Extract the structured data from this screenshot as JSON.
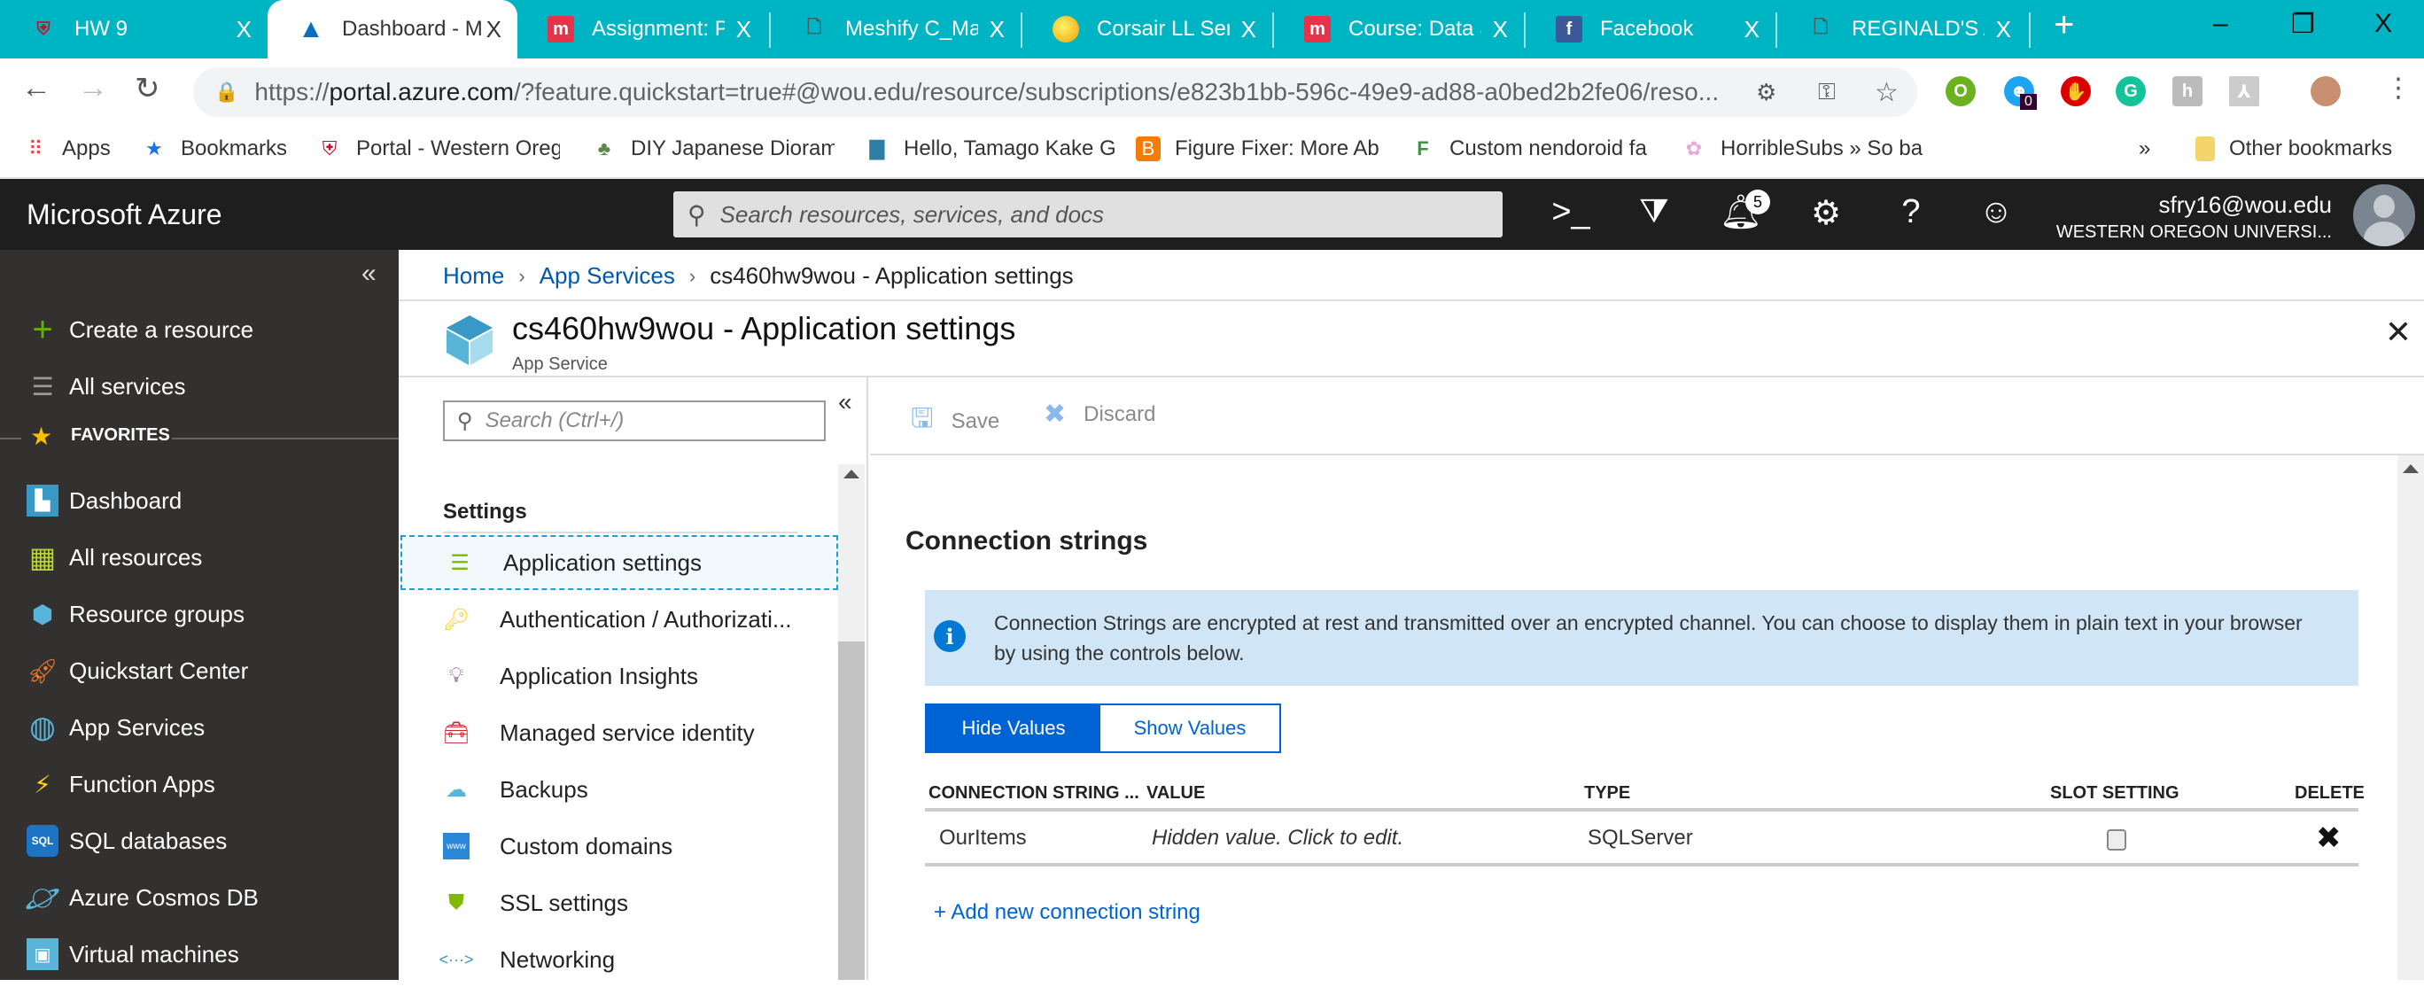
{
  "browser": {
    "tabs": [
      {
        "label": "HW 9",
        "icon": "wou-crest-icon",
        "active": false
      },
      {
        "label": "Dashboard - Microsoft Azure",
        "icon": "azure-logo-icon",
        "active": true
      },
      {
        "label": "Assignment: Po",
        "icon": "moodle-icon",
        "active": false
      },
      {
        "label": "Meshify C_Man",
        "icon": "document-icon",
        "active": false
      },
      {
        "label": "Corsair LL Series",
        "icon": "egg-icon",
        "active": false
      },
      {
        "label": "Course: Data S",
        "icon": "moodle-icon",
        "active": false
      },
      {
        "label": "Facebook",
        "icon": "facebook-icon",
        "active": false
      },
      {
        "label": "REGINALD'S AI",
        "icon": "document-icon",
        "active": false
      }
    ],
    "new_tab": "+",
    "tab_close": "X",
    "window_controls": {
      "minimize": "–",
      "restore": "❐",
      "close": "X"
    },
    "url_prefix": "https://",
    "url_host": "portal.azure.com",
    "url_rest": "/?feature.quickstart=true#@wou.edu/resource/subscriptions/e823b1bb-596c-49e9-ad88-a0bed2b2fe06/reso...",
    "extension_badge": "0",
    "bookmarks": [
      {
        "label": "Apps",
        "icon": "apps-grid-icon"
      },
      {
        "label": "Bookmarks",
        "icon": "star-icon"
      },
      {
        "label": "Portal - Western Oreg",
        "icon": "wou-crest-icon"
      },
      {
        "label": "DIY Japanese Dioram",
        "icon": "plant-icon"
      },
      {
        "label": "Hello, Tamago Kake G",
        "icon": "bin-icon"
      },
      {
        "label": "Figure Fixer: More Ab",
        "icon": "blogger-icon"
      },
      {
        "label": "Custom nendoroid fa",
        "icon": "fp-icon"
      },
      {
        "label": "HorribleSubs » So ba",
        "icon": "flower-icon"
      }
    ],
    "bookmarks_overflow": "»",
    "other_bookmarks": "Other bookmarks"
  },
  "azure": {
    "brand": "Microsoft Azure",
    "search_placeholder": "Search resources, services, and docs",
    "notifications_count": "5",
    "account_email": "sfry16@wou.edu",
    "account_org": "WESTERN OREGON UNIVERSI..."
  },
  "sidebar": {
    "top_items": [
      {
        "label": "Create a resource",
        "icon": "plus-icon"
      },
      {
        "label": "All services",
        "icon": "list-icon"
      }
    ],
    "favorites_label": "FAVORITES",
    "favorites": [
      {
        "label": "Dashboard",
        "icon": "dashboard-icon"
      },
      {
        "label": "All resources",
        "icon": "grid-icon"
      },
      {
        "label": "Resource groups",
        "icon": "resource-group-icon"
      },
      {
        "label": "Quickstart Center",
        "icon": "rocket-icon"
      },
      {
        "label": "App Services",
        "icon": "app-services-icon"
      },
      {
        "label": "Function Apps",
        "icon": "function-apps-icon"
      },
      {
        "label": "SQL databases",
        "icon": "sql-icon"
      },
      {
        "label": "Azure Cosmos DB",
        "icon": "cosmos-icon"
      },
      {
        "label": "Virtual machines",
        "icon": "vm-icon"
      }
    ]
  },
  "breadcrumb": [
    {
      "label": "Home",
      "link": true
    },
    {
      "label": "App Services",
      "link": true
    },
    {
      "label": "cs460hw9wou - Application settings",
      "link": false
    }
  ],
  "blade": {
    "title": "cs460hw9wou - Application settings",
    "subtitle": "App Service"
  },
  "resource_menu": {
    "search_placeholder": "Search (Ctrl+/)",
    "section": "Settings",
    "items": [
      {
        "label": "Application settings",
        "icon": "app-settings-icon",
        "selected": true
      },
      {
        "label": "Authentication / Authorizati...",
        "icon": "key-icon",
        "selected": false
      },
      {
        "label": "Application Insights",
        "icon": "lightbulb-icon",
        "selected": false
      },
      {
        "label": "Managed service identity",
        "icon": "toolbox-icon",
        "selected": false
      },
      {
        "label": "Backups",
        "icon": "cloud-icon",
        "selected": false
      },
      {
        "label": "Custom domains",
        "icon": "www-icon",
        "selected": false
      },
      {
        "label": "SSL settings",
        "icon": "shield-lock-icon",
        "selected": false
      },
      {
        "label": "Networking",
        "icon": "networking-icon",
        "selected": false
      }
    ]
  },
  "toolbar": {
    "save_label": "Save",
    "discard_label": "Discard"
  },
  "connection_strings": {
    "title": "Connection strings",
    "info": "Connection Strings are encrypted at rest and transmitted over an encrypted channel. You can choose to display them in plain text in your browser by using the controls below.",
    "hide_label": "Hide Values",
    "show_label": "Show Values",
    "columns": [
      "CONNECTION STRING ...",
      "VALUE",
      "TYPE",
      "SLOT SETTING",
      "DELETE"
    ],
    "rows": [
      {
        "name": "OurItems",
        "value": "Hidden value. Click to edit.",
        "type": "SQLServer",
        "slot_setting": false
      }
    ],
    "add_label": "+ Add new connection string"
  }
}
